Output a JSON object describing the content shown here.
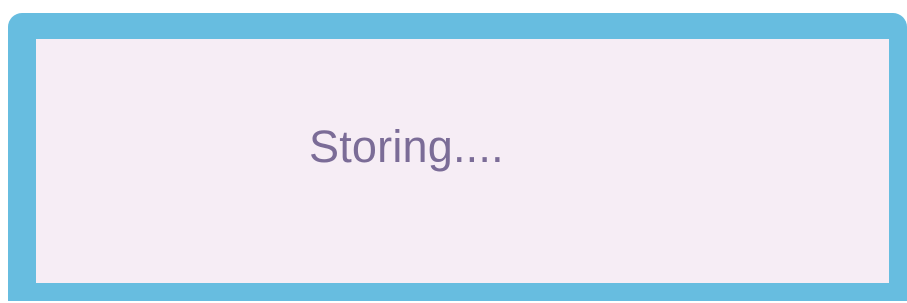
{
  "dialog": {
    "status_text": "Storing....",
    "colors": {
      "frame": "#67bde0",
      "body": "#f6edf5",
      "text": "#7b6c97"
    }
  }
}
